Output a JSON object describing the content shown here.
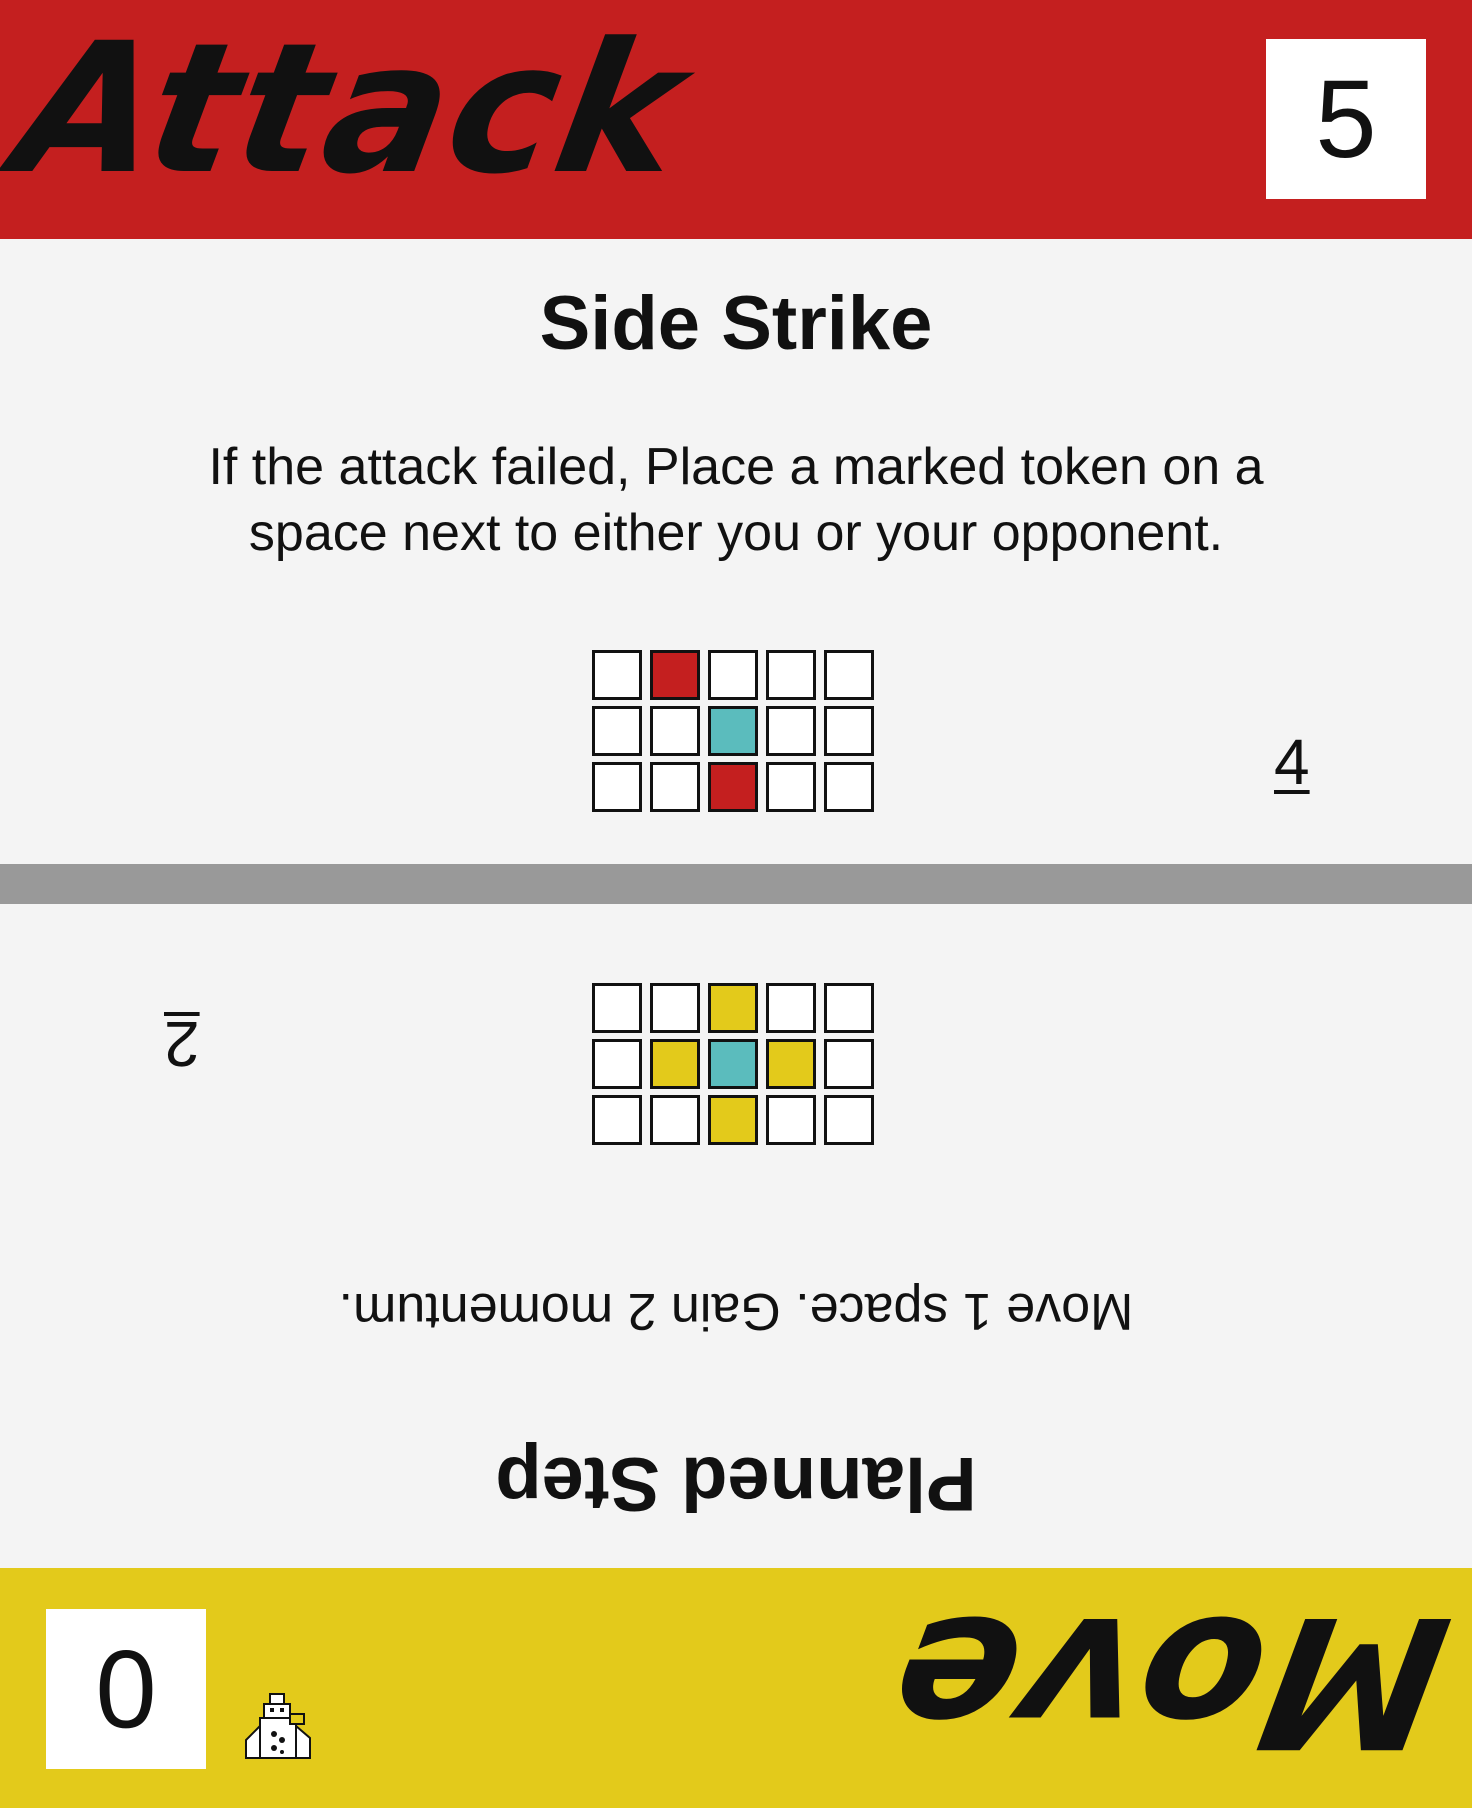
{
  "top_half": {
    "type_label": "Attack",
    "cost": "5",
    "card_name": "Side Strike",
    "card_text": "If the attack failed, Place a marked token on a space next to either you or your opponent.",
    "number": "4",
    "accent_color": "#c41f1f",
    "grid": [
      [
        "empty",
        "red",
        "empty",
        "empty",
        "empty"
      ],
      [
        "empty",
        "empty",
        "teal",
        "empty",
        "empty"
      ],
      [
        "empty",
        "empty",
        "red",
        "empty",
        "empty"
      ]
    ]
  },
  "bottom_half": {
    "type_label": "Move",
    "cost": "0",
    "card_name": "Planned Step",
    "card_text": "Move 1 space. Gain 2 momentum.",
    "number": "2",
    "accent_color": "#e3ca1b",
    "icon": "robot-icon",
    "grid": [
      [
        "empty",
        "empty",
        "yellow",
        "empty",
        "empty"
      ],
      [
        "empty",
        "yellow",
        "teal",
        "yellow",
        "empty"
      ],
      [
        "empty",
        "empty",
        "yellow",
        "empty",
        "empty"
      ]
    ]
  },
  "colors": {
    "red": "#c41f1f",
    "yellow": "#e3ca1b",
    "teal": "#5bbcbd",
    "divider": "#999999",
    "background": "#f4f4f4"
  }
}
